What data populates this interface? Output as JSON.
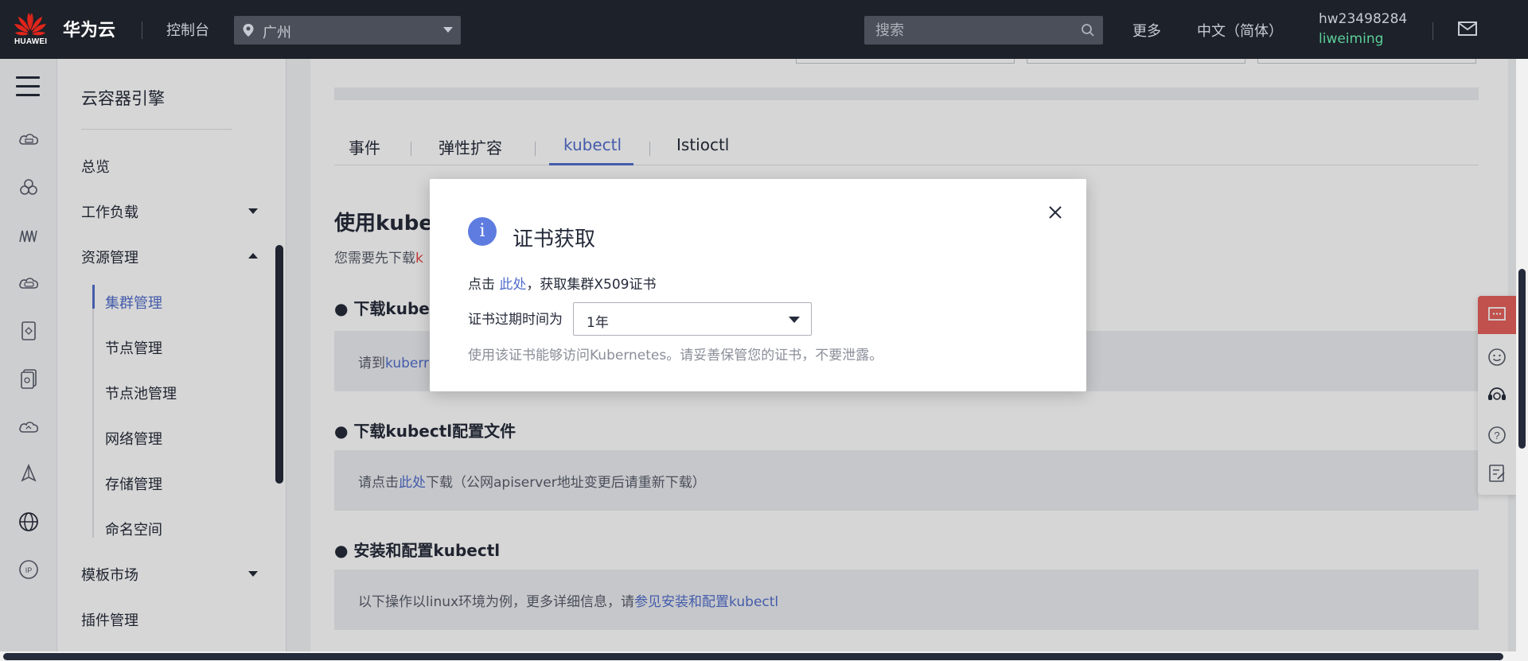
{
  "topbar": {
    "logo_text": "HUAWEI",
    "brand": "华为云",
    "console": "控制台",
    "region": "广州",
    "search_placeholder": "搜索",
    "more": "更多",
    "language": "中文（简体）",
    "account": "hw23498284",
    "username": "liweiming",
    "logo_icon": "huawei-flower-icon",
    "mail_icon": "mail-icon"
  },
  "rail": {
    "icons": [
      "menu-icon",
      "cloud-server-icon",
      "cluster-icon",
      "network-icon",
      "storage-icon",
      "container-icon",
      "image-icon",
      "cloud-icon",
      "deploy-icon",
      "globe-icon",
      "ip-icon"
    ]
  },
  "nav": {
    "title": "云容器引擎",
    "items": {
      "overview": "总览",
      "workload": "工作负载",
      "resource": "资源管理",
      "cluster": "集群管理",
      "node": "节点管理",
      "nodepool": "节点池管理",
      "network": "网络管理",
      "storage": "存储管理",
      "namespace": "命名空间",
      "template": "模板市场",
      "plugin": "插件管理"
    }
  },
  "main": {
    "tabs": [
      "事件",
      "弹性扩容",
      "kubectl",
      "Istioctl"
    ],
    "active_tab": "kubectl",
    "heading": "使用kubect",
    "note_prefix": "您需要先下载",
    "note_red": "k",
    "section1_title": "● 下载kubect",
    "section1_prefix": "请到",
    "section1_link": "kuberr",
    "section2_title": "● 下载kubectl配置文件",
    "section2_prefix": "请点击",
    "section2_link": "此处",
    "section2_suffix": "下载（公网apiserver地址变更后请重新下载）",
    "section3_title": "● 安装和配置kubectl",
    "section3_prefix": "以下操作以linux环境为例，更多详细信息，请",
    "section3_link": "参见安装和配置kubectl"
  },
  "modal": {
    "title": "证书获取",
    "line1_prefix": "点击",
    "line1_link": "此处",
    "line1_suffix": "，获取集群X509证书",
    "expiry_label": "证书过期时间为",
    "expiry_value": "1年",
    "hint": "使用该证书能够访问Kubernetes。请妥善保管您的证书，不要泄露。",
    "info_glyph": "i"
  },
  "float_tools": [
    "chat-icon",
    "smile-icon",
    "support-icon",
    "help-icon",
    "feedback-icon"
  ],
  "colors": {
    "topbar_bg": "#1d2129",
    "accent": "#526ecc",
    "modal_icon": "#5e7ce0",
    "link_red": "#e54545",
    "username_green": "#5ccf9a",
    "float_red": "#e5615b"
  }
}
